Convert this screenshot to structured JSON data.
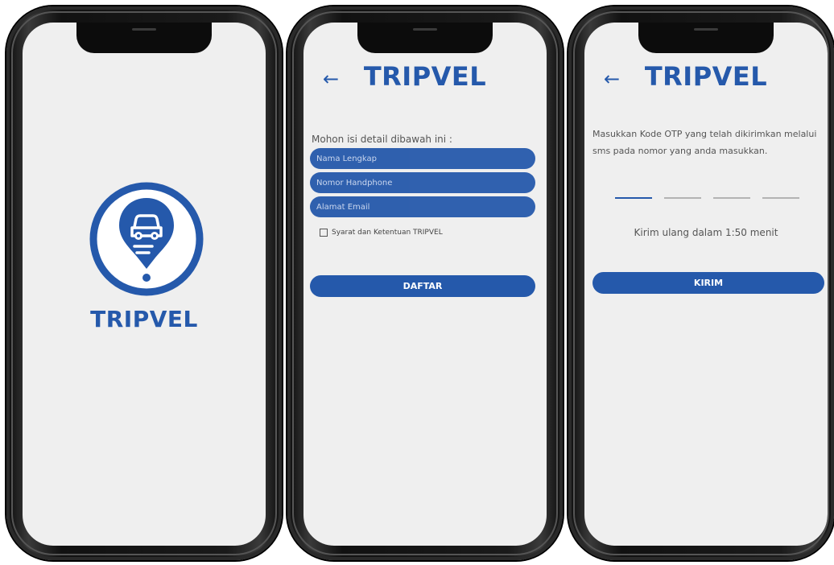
{
  "app_name": "TRIPVEL",
  "colors": {
    "brand": "#2559ab",
    "screen_bg": "#efefef"
  },
  "splash": {
    "logo_icon": "map-pin-car-icon",
    "title": "TRIPVEL"
  },
  "register": {
    "back_icon": "←",
    "title": "TRIPVEL",
    "instruction": "Mohon isi detail dibawah ini :",
    "fields": {
      "name_placeholder": "Nama Lengkap",
      "phone_placeholder": "Nomor Handphone",
      "email_placeholder": "Alamat Email"
    },
    "terms_label": "Syarat dan Ketentuan TRIPVEL",
    "submit_label": "DAFTAR"
  },
  "otp": {
    "back_icon": "←",
    "title": "TRIPVEL",
    "instruction": "Masukkan Kode OTP yang telah dikirimkan melalui sms pada nomor yang anda masukkan.",
    "resend_text": "Kirim ulang dalam 1:50 menit",
    "submit_label": "KIRIM"
  }
}
